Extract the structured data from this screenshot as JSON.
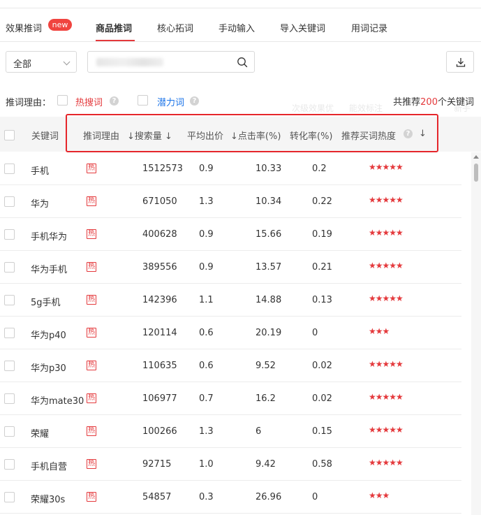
{
  "tabs": [
    {
      "label": "效果推词",
      "badge": "new"
    },
    {
      "label": "商品推词"
    },
    {
      "label": "核心拓词"
    },
    {
      "label": "手动输入"
    },
    {
      "label": "导入关键词"
    },
    {
      "label": "用词记录"
    }
  ],
  "filter": {
    "select_value": "全部",
    "search_value": ""
  },
  "reason": {
    "label": "推词理由：",
    "options": [
      {
        "label": "热搜词",
        "color": "#e4393c"
      },
      {
        "label": "潜力词",
        "color": "#1a73e8"
      }
    ]
  },
  "total": {
    "prefix": "共推荐",
    "count": "200",
    "suffix": "个关键词"
  },
  "ghost_text": {
    "a": "次级效果优",
    "b": "能效标注",
    "c": "新手"
  },
  "table": {
    "headers": {
      "keyword": "关键词",
      "reason": "推词理由",
      "search": "↓搜索量 ↓",
      "price": "平均出价",
      "ctr": "↓点击率(%)",
      "cvr": "转化率(%)",
      "heat": "推荐买词热度",
      "heat_sort": "↓"
    },
    "hot_label": "热",
    "rows": [
      {
        "keyword": "手机",
        "search": "1512573",
        "price": "0.9",
        "ctr": "10.33",
        "cvr": "0.2",
        "stars": "★★★★★"
      },
      {
        "keyword": "华为",
        "search": "671050",
        "price": "1.3",
        "ctr": "10.34",
        "cvr": "0.22",
        "stars": "★★★★★"
      },
      {
        "keyword": "手机华为",
        "search": "400628",
        "price": "0.9",
        "ctr": "15.66",
        "cvr": "0.19",
        "stars": "★★★★★"
      },
      {
        "keyword": "华为手机",
        "search": "389556",
        "price": "0.9",
        "ctr": "13.57",
        "cvr": "0.21",
        "stars": "★★★★★"
      },
      {
        "keyword": "5g手机",
        "search": "142396",
        "price": "1.1",
        "ctr": "14.88",
        "cvr": "0.13",
        "stars": "★★★★★"
      },
      {
        "keyword": "华为p40",
        "search": "120114",
        "price": "0.6",
        "ctr": "20.19",
        "cvr": "0",
        "stars": "★★★"
      },
      {
        "keyword": "华为p30",
        "search": "110635",
        "price": "0.6",
        "ctr": "9.52",
        "cvr": "0.02",
        "stars": "★★★★★"
      },
      {
        "keyword": "华为mate30",
        "search": "106977",
        "price": "0.7",
        "ctr": "16.2",
        "cvr": "0.02",
        "stars": "★★★★★"
      },
      {
        "keyword": "荣耀",
        "search": "100266",
        "price": "1.3",
        "ctr": "6",
        "cvr": "0.15",
        "stars": "★★★★★"
      },
      {
        "keyword": "手机自营",
        "search": "92715",
        "price": "1.0",
        "ctr": "9.42",
        "cvr": "0.58",
        "stars": "★★★★★"
      },
      {
        "keyword": "荣耀30s",
        "search": "54857",
        "price": "0.3",
        "ctr": "26.96",
        "cvr": "0",
        "stars": "★★★"
      }
    ]
  },
  "colors": {
    "accent": "#e4393c",
    "link": "#1a73e8",
    "highlight_box": "#e5262b"
  }
}
